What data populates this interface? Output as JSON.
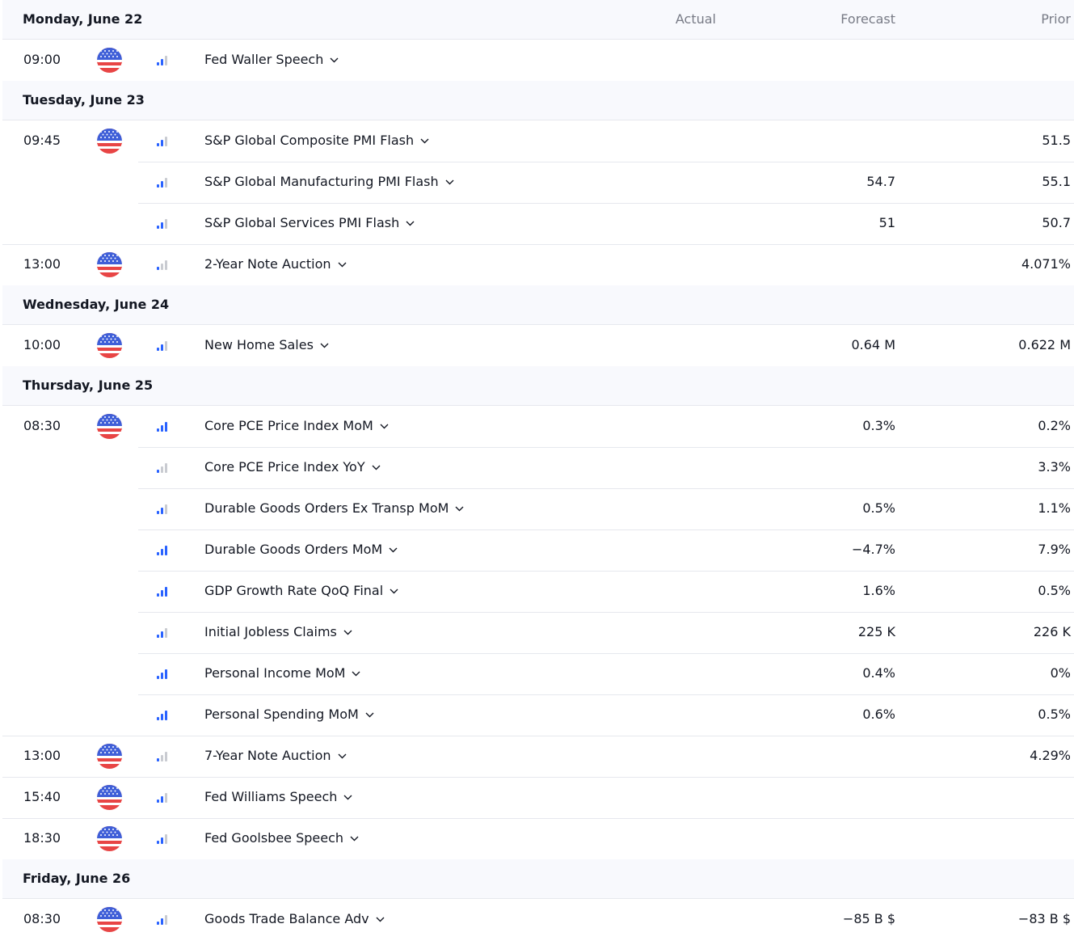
{
  "columns": {
    "actual": "Actual",
    "forecast": "Forecast",
    "prior": "Prior"
  },
  "colors": {
    "importance_active": "#2962ff",
    "importance_inactive": "#c9cbd1",
    "header_bg": "#f8f9fd",
    "divider": "#e6e8ee",
    "muted_text": "#787b86"
  },
  "days": [
    {
      "date": "Monday, June 22",
      "events": [
        {
          "time": "09:00",
          "flag": "us-flag-icon",
          "importance": 1,
          "title": "Fed Waller Speech",
          "actual": "",
          "forecast": "",
          "prior": ""
        }
      ]
    },
    {
      "date": "Tuesday, June 23",
      "events": [
        {
          "time": "09:45",
          "flag": "us-flag-icon",
          "importance": 1,
          "title": "S&P Global Composite PMI Flash",
          "actual": "",
          "forecast": "",
          "prior": "51.5"
        },
        {
          "time": "",
          "flag": "",
          "importance": 1,
          "title": "S&P Global Manufacturing PMI Flash",
          "actual": "",
          "forecast": "54.7",
          "prior": "55.1"
        },
        {
          "time": "",
          "flag": "",
          "importance": 1,
          "title": "S&P Global Services PMI Flash",
          "actual": "",
          "forecast": "51",
          "prior": "50.7"
        },
        {
          "time": "13:00",
          "flag": "us-flag-icon",
          "importance": 0,
          "title": "2-Year Note Auction",
          "actual": "",
          "forecast": "",
          "prior": "4.071%"
        }
      ]
    },
    {
      "date": "Wednesday, June 24",
      "events": [
        {
          "time": "10:00",
          "flag": "us-flag-icon",
          "importance": 1,
          "title": "New Home Sales",
          "actual": "",
          "forecast": "0.64 M",
          "prior": "0.622 M"
        }
      ]
    },
    {
      "date": "Thursday, June 25",
      "events": [
        {
          "time": "08:30",
          "flag": "us-flag-icon",
          "importance": 2,
          "title": "Core PCE Price Index MoM",
          "actual": "",
          "forecast": "0.3%",
          "prior": "0.2%"
        },
        {
          "time": "",
          "flag": "",
          "importance": 0,
          "title": "Core PCE Price Index YoY",
          "actual": "",
          "forecast": "",
          "prior": "3.3%"
        },
        {
          "time": "",
          "flag": "",
          "importance": 1,
          "title": "Durable Goods Orders Ex Transp MoM",
          "actual": "",
          "forecast": "0.5%",
          "prior": "1.1%"
        },
        {
          "time": "",
          "flag": "",
          "importance": 2,
          "title": "Durable Goods Orders MoM",
          "actual": "",
          "forecast": "−4.7%",
          "prior": "7.9%"
        },
        {
          "time": "",
          "flag": "",
          "importance": 2,
          "title": "GDP Growth Rate QoQ Final",
          "actual": "",
          "forecast": "1.6%",
          "prior": "0.5%"
        },
        {
          "time": "",
          "flag": "",
          "importance": 1,
          "title": "Initial Jobless Claims",
          "actual": "",
          "forecast": "225 K",
          "prior": "226 K"
        },
        {
          "time": "",
          "flag": "",
          "importance": 2,
          "title": "Personal Income MoM",
          "actual": "",
          "forecast": "0.4%",
          "prior": "0%"
        },
        {
          "time": "",
          "flag": "",
          "importance": 2,
          "title": "Personal Spending MoM",
          "actual": "",
          "forecast": "0.6%",
          "prior": "0.5%"
        },
        {
          "time": "13:00",
          "flag": "us-flag-icon",
          "importance": 0,
          "title": "7-Year Note Auction",
          "actual": "",
          "forecast": "",
          "prior": "4.29%"
        },
        {
          "time": "15:40",
          "flag": "us-flag-icon",
          "importance": 1,
          "title": "Fed Williams Speech",
          "actual": "",
          "forecast": "",
          "prior": ""
        },
        {
          "time": "18:30",
          "flag": "us-flag-icon",
          "importance": 1,
          "title": "Fed Goolsbee Speech",
          "actual": "",
          "forecast": "",
          "prior": ""
        }
      ]
    },
    {
      "date": "Friday, June 26",
      "events": [
        {
          "time": "08:30",
          "flag": "us-flag-icon",
          "importance": 1,
          "title": "Goods Trade Balance Adv",
          "actual": "",
          "forecast": "−85 B $",
          "prior": "−83 B $"
        }
      ]
    }
  ]
}
